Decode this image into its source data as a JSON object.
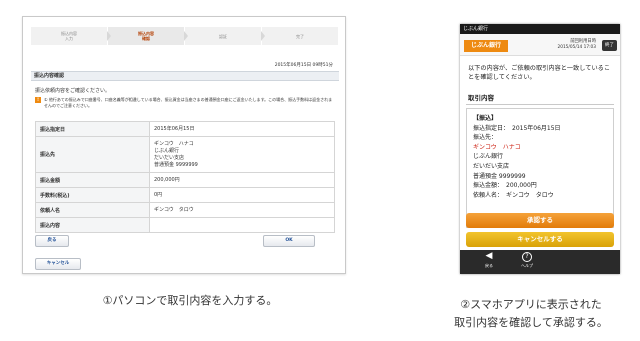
{
  "pc": {
    "steps": [
      {
        "label": "振込内容\n入力",
        "active": false
      },
      {
        "label": "振込内容\n確認",
        "active": true
      },
      {
        "label": "認証",
        "active": false
      },
      {
        "label": "完了",
        "active": false
      }
    ],
    "datetime": "2015年06月15日 09時51分",
    "section_title": "振込内容確認",
    "intro": "振込依頼内容をご確認ください。",
    "notice": "① 他行あての振込みで口座番号、口座名義等が相違している場合、振込資金は当座さまの普通預金口座にご返金いたします。この場合、振込手数料は返金されませんのでご注意ください。",
    "rows": [
      {
        "label": "振込指定日",
        "value": "2015年06月15日"
      },
      {
        "label": "振込先",
        "value": "ギンコウ　ハナコ\nじぶん銀行\nだいだい支店\n普通預金 9999999"
      },
      {
        "label": "振込金額",
        "value": "200,000円"
      },
      {
        "label": "手数料(税込)",
        "value": "0円"
      },
      {
        "label": "依頼人名",
        "value": "ギンコウ　タロウ"
      },
      {
        "label": "振込内容",
        "value": ""
      }
    ],
    "back_label": "戻る",
    "ok_label": "OK",
    "cancel_label": "キャンセル"
  },
  "phone": {
    "status_title": "じぶん銀行",
    "logo": "じぶん銀行",
    "last_login_label": "前回利用日時",
    "last_login_value": "2015/05/14 17:03",
    "end_label": "終了",
    "message": "以下の内容が、ご依頼の取引内容と一致していることを確認してください。",
    "title": "取引内容",
    "card": {
      "heading": "【振込】",
      "date": "振込指定日：　2015年06月15日",
      "dest_label": "振込先：",
      "dest_name": "ギンコウ　ハナコ",
      "bank": "じぶん銀行",
      "branch": "だいだい支店",
      "account": "普通預金 9999999",
      "amount": "振込金額：　200,000円",
      "requester": "依頼人名：　ギンコウ　タロウ"
    },
    "approve_label": "承認する",
    "cancel_label": "キャンセルする",
    "nav_back": "戻る",
    "nav_help": "ヘルプ"
  },
  "captions": {
    "left": "①パソコンで取引内容を入力する。",
    "right_line1": "②スマホアプリに表示された",
    "right_line2": "取引内容を確認して承認する。"
  },
  "colors": {
    "accent_orange": "#e27b09",
    "accent_yellow": "#d9a208",
    "warn_red": "#cc1f10"
  }
}
